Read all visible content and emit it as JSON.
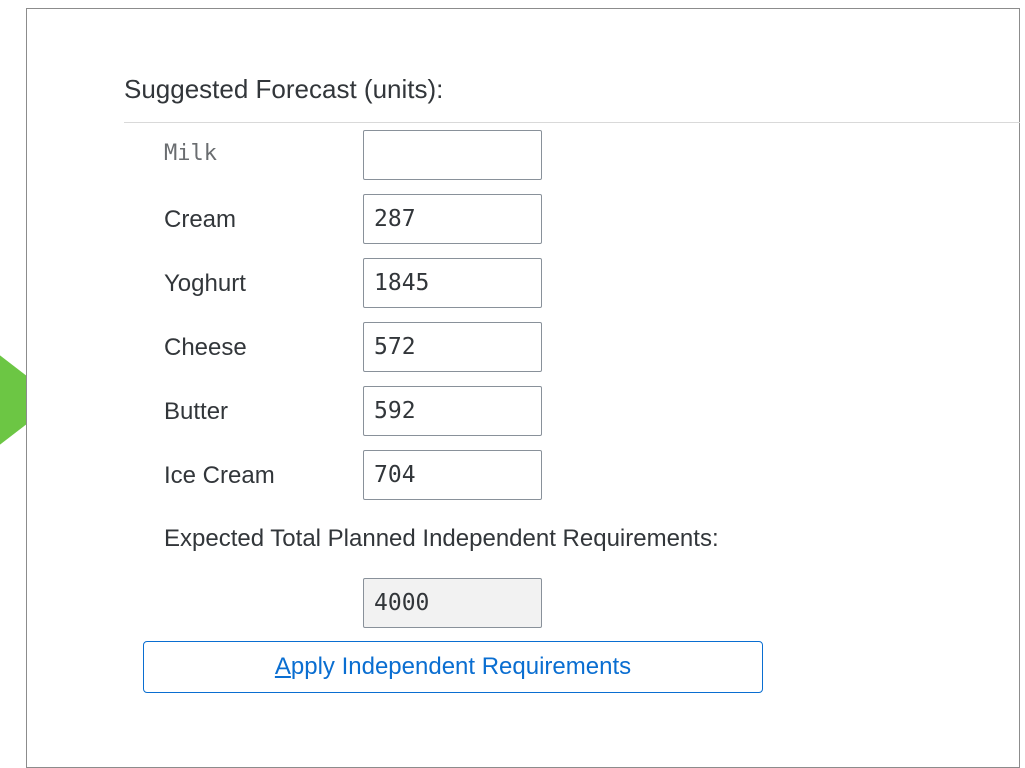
{
  "section": {
    "title": "Suggested Forecast (units):"
  },
  "forecast": {
    "rows": [
      {
        "label": "Milk",
        "value": ""
      },
      {
        "label": "Cream",
        "value": "287"
      },
      {
        "label": "Yoghurt",
        "value": "1845"
      },
      {
        "label": "Cheese",
        "value": "572"
      },
      {
        "label": "Butter",
        "value": "592"
      },
      {
        "label": "Ice Cream",
        "value": "704"
      }
    ]
  },
  "total": {
    "label": "Expected Total Planned Independent Requirements:",
    "value": "4000"
  },
  "apply_button": {
    "mnemonic": "A",
    "label_rest": "pply Independent Requirements"
  },
  "colors": {
    "accent": "#0a6ed1",
    "arrow": "#6cc644"
  }
}
